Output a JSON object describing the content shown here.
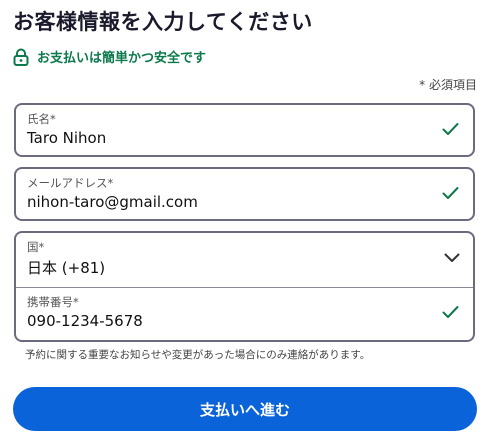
{
  "title": "お客様情報を入力してください",
  "secure_note": "お支払いは簡単かつ安全です",
  "required_note": "* 必須項目",
  "fields": {
    "name": {
      "label": "氏名*",
      "value": "Taro Nihon"
    },
    "email": {
      "label": "メールアドレス*",
      "value": "nihon-taro@gmail.com"
    },
    "country": {
      "label": "国*",
      "value": "日本 (+81)"
    },
    "phone": {
      "label": "携帯番号*",
      "value": "090-1234-5678"
    }
  },
  "helper_text": "予約に関する重要なお知らせや変更があった場合にのみ連絡があります。",
  "submit_label": "支払いへ進む",
  "colors": {
    "accent": "#0a63d8",
    "success": "#0c7a4c",
    "text": "#1a1a2c",
    "border": "#6b6b80"
  },
  "icons": {
    "secure": "lock-icon",
    "valid": "checkmark-icon",
    "dropdown": "chevron-down-icon"
  }
}
